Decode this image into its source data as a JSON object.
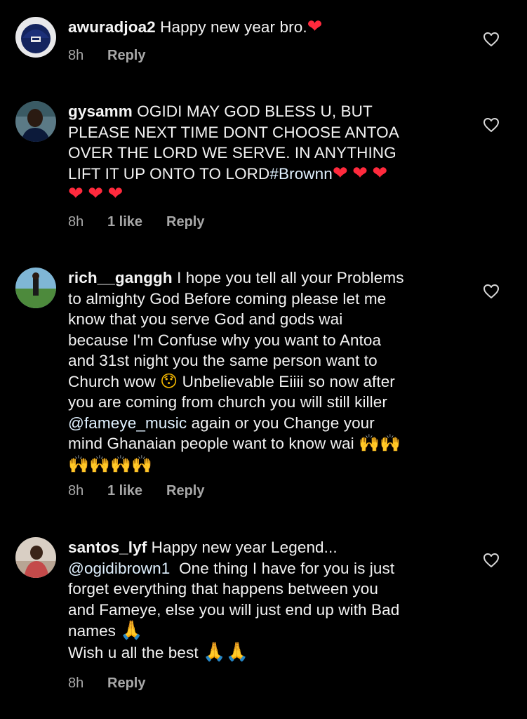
{
  "comments": [
    {
      "username": "awuradjoa2",
      "text": "Happy new year bro.",
      "time": "8h",
      "likes": "",
      "reply": "Reply"
    },
    {
      "username": "gysamm",
      "text_line1": "OGIDI MAY GOD BLESS U, BUT",
      "text_line2": "PLEASE NEXT TIME DONT CHOOSE ANTOA",
      "text_line3": "OVER THE LORD WE SERVE.  IN ANYTHING",
      "text_line4": "LIFT IT UP ONTO TO LORD",
      "hashtag": "#Brownn",
      "time": "8h",
      "likes": "1 like",
      "reply": "Reply"
    },
    {
      "username": "rich__ganggh",
      "text_line1": "I hope you tell all your Problems",
      "text_line2": "to almighty God Before coming please let me",
      "text_line3": "know that you serve God and gods wai",
      "text_line4": "because I'm Confuse why you want to Antoa",
      "text_line5": "and 31st night you the same person want to",
      "text_line6a": "Church wow",
      "text_line6b": "Unbelievable Eiiii so now after",
      "text_line7": "you are coming from church you will still killer",
      "mention": "@fameye_music",
      "text_line8b": "again or you Change your",
      "text_line9": "mind Ghanaian people want to know wai",
      "time": "8h",
      "likes": "1 like",
      "reply": "Reply"
    },
    {
      "username": "santos_lyf",
      "text_line1": "Happy new year Legend...",
      "mention": "@ogidibrown1",
      "text_line2b": "One thing I have for you is just",
      "text_line3": "forget everything that happens between you",
      "text_line4": "and Fameye, else you will just end up with Bad",
      "text_line5": "names",
      "text_line6": "Wish u all the best",
      "time": "8h",
      "likes": "",
      "reply": "Reply"
    }
  ],
  "icons": {
    "heart_emoji": "❤",
    "raised_hands_emoji": "🙌",
    "pray_emoji": "🙏",
    "hushed_face_emoji": "😯",
    "like": "heart-outline-icon"
  },
  "colors": {
    "background": "#000000",
    "text": "#f2f2f2",
    "meta": "#a8a8a8",
    "heart": "#ff2a3d",
    "mention": "#e0f1ff"
  }
}
